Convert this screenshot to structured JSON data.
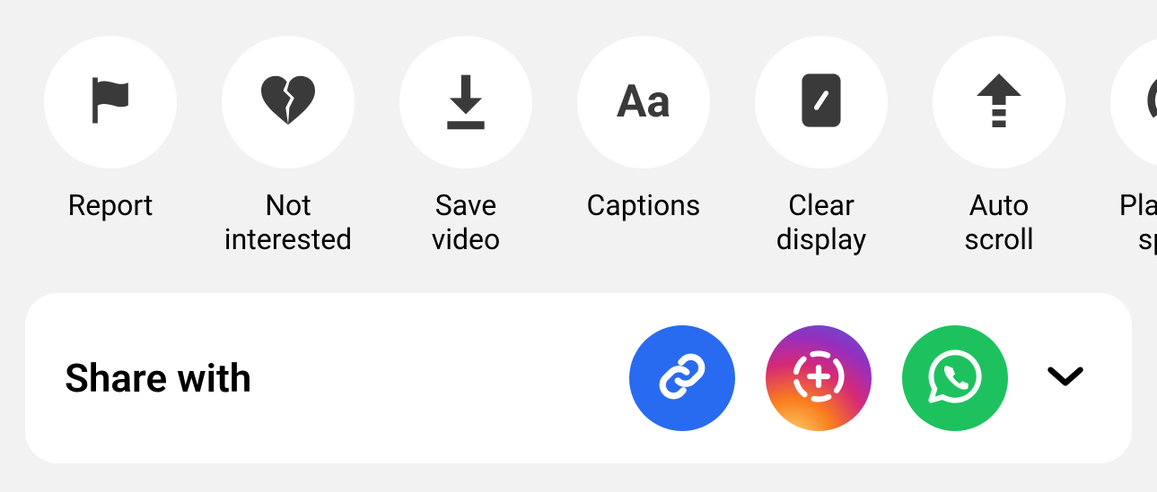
{
  "actions": [
    {
      "id": "report",
      "label": "Report"
    },
    {
      "id": "not-interested",
      "label": "Not\ninterested"
    },
    {
      "id": "save-video",
      "label": "Save video"
    },
    {
      "id": "captions",
      "label": "Captions"
    },
    {
      "id": "clear-display",
      "label": "Clear\ndisplay"
    },
    {
      "id": "auto-scroll",
      "label": "Auto scroll"
    },
    {
      "id": "playback-speed",
      "label": "Playback\nspeed"
    }
  ],
  "share": {
    "title": "Share with",
    "options": [
      {
        "id": "copy-link"
      },
      {
        "id": "instagram-stories"
      },
      {
        "id": "whatsapp"
      }
    ]
  }
}
